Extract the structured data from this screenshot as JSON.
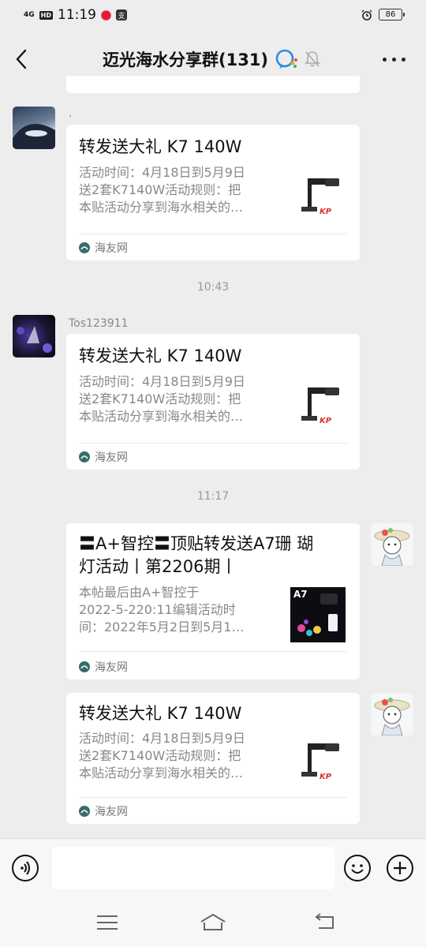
{
  "status_bar": {
    "network": "4G",
    "hd": "HD",
    "time": "11:19",
    "app_glyph": "支",
    "battery": "86"
  },
  "header": {
    "title": "迈光海水分享群(131)",
    "back_icon": "chevron-left-icon",
    "more_icon": "more-horizontal-icon",
    "mute_icon": "bell-off-icon"
  },
  "messages": [
    {
      "sender": ".",
      "title": "转发送大礼 K7 140W",
      "desc": [
        "活动时间：4月18日到5月9日",
        "送2套K7140W活动规则：把",
        "本贴活动分享到海水相关的…"
      ],
      "source": "海友网"
    },
    {
      "timestamp": "10:43",
      "sender": "Tos123911",
      "title": "转发送大礼 K7 140W",
      "desc": [
        "活动时间：4月18日到5月9日",
        "送2套K7140W活动规则：把",
        "本贴活动分享到海水相关的…"
      ],
      "source": "海友网"
    },
    {
      "timestamp": "11:17",
      "title_lines": [
        "〓A+智控〓顶贴转发送A7珊 瑚",
        "灯活动丨第2206期丨"
      ],
      "desc": [
        "本帖最后由A+智控于",
        "2022-5-220:11编辑活动时",
        "间：2022年5月2日到5月1…"
      ],
      "thumb_label": "A7",
      "source": "海友网"
    },
    {
      "title": "转发送大礼 K7 140W",
      "desc": [
        "活动时间：4月18日到5月9日",
        "送2套K7140W活动规则：把",
        "本贴活动分享到海水相关的…"
      ],
      "source": "海友网"
    }
  ],
  "input_bar": {
    "voice_icon": "voice-icon",
    "emoji_icon": "emoji-icon",
    "plus_icon": "plus-icon",
    "placeholder": ""
  },
  "nav_bar": {
    "menu_icon": "menu-icon",
    "home_icon": "home-icon",
    "back_icon": "back-icon"
  }
}
